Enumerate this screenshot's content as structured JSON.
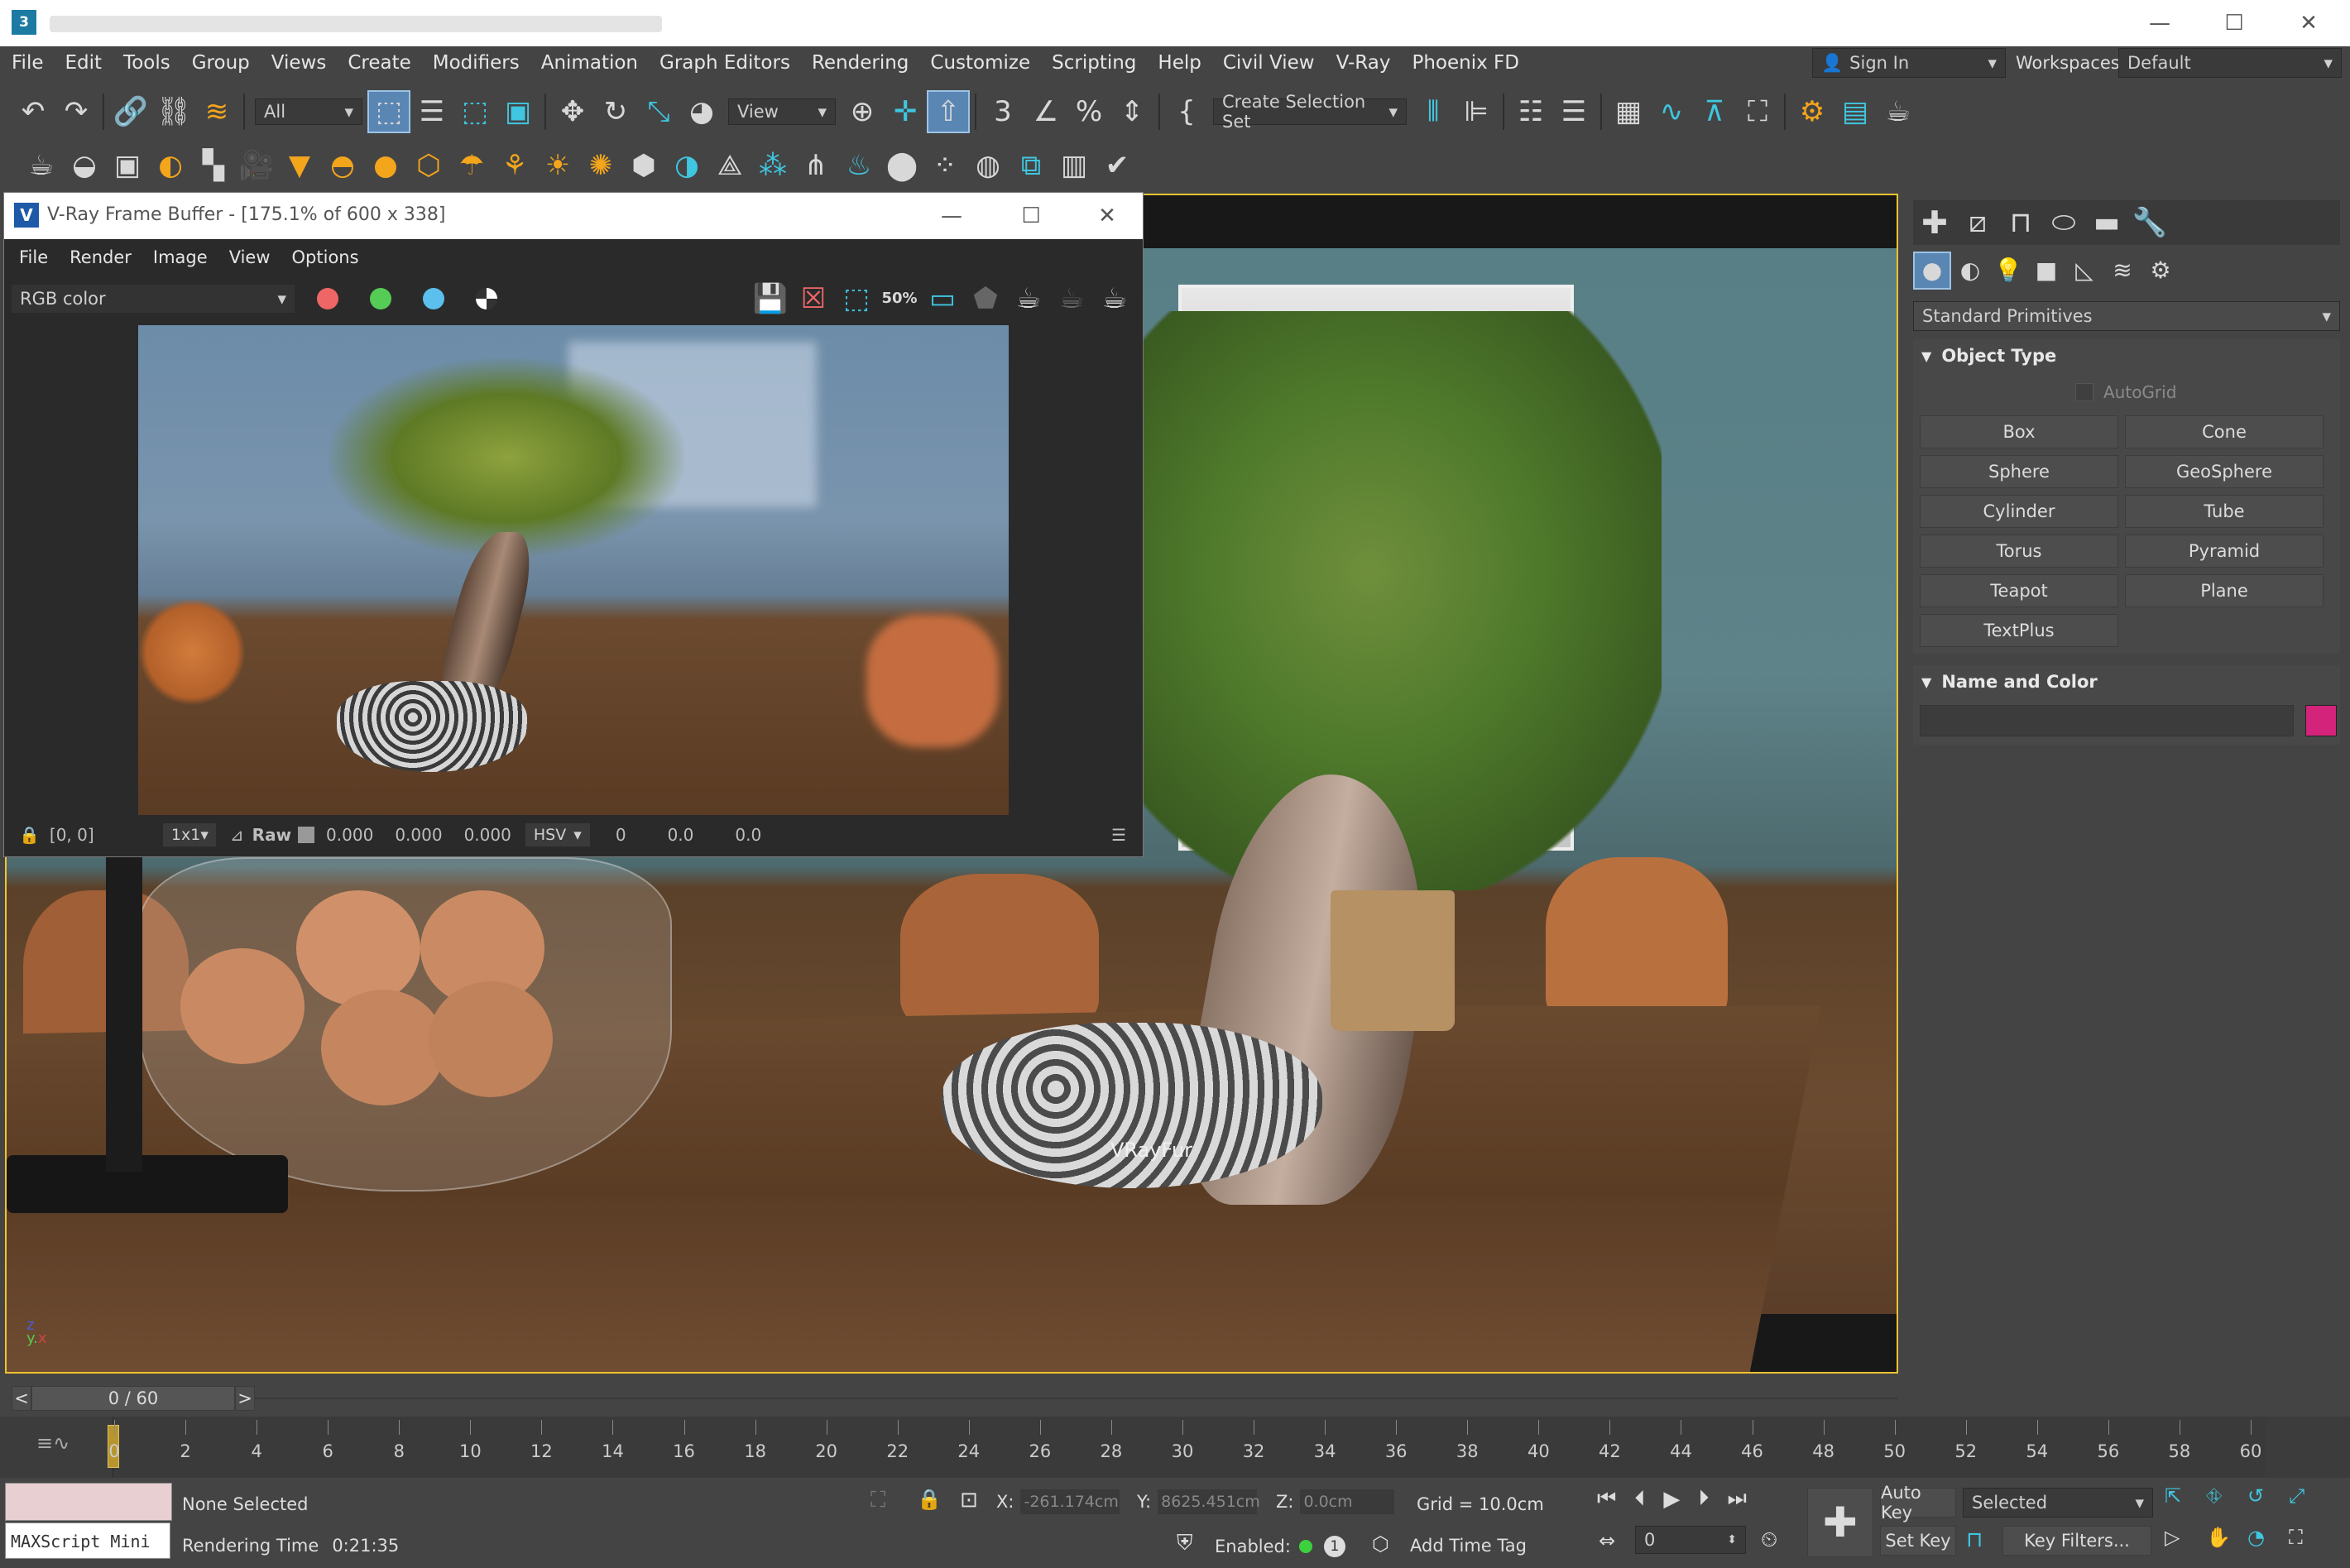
{
  "titlebar": {
    "app_icon": "3",
    "minimize": "—",
    "maximize": "☐",
    "close": "✕"
  },
  "menu": [
    "File",
    "Edit",
    "Tools",
    "Group",
    "Views",
    "Create",
    "Modifiers",
    "Animation",
    "Graph Editors",
    "Rendering",
    "Customize",
    "Scripting",
    "Help",
    "Civil View",
    "V-Ray",
    "Phoenix FD"
  ],
  "account": {
    "sign_in": "Sign In",
    "workspaces_label": "Workspaces:",
    "workspace_value": "Default"
  },
  "toolbar": {
    "filter_value": "All",
    "ref_coord_value": "View",
    "selection_set_placeholder": "Create Selection Set"
  },
  "vfb": {
    "title": "V-Ray Frame Buffer - [175.1% of 600 x 338]",
    "menu": [
      "File",
      "Render",
      "Image",
      "View",
      "Options"
    ],
    "channel_value": "RGB color",
    "zoom_label": "50%",
    "coords": "[0, 0]",
    "sample_size": "1x1",
    "raw_label": "Raw",
    "raw_values": [
      "0.000",
      "0.000",
      "0.000"
    ],
    "color_mode": "HSV",
    "color_values": [
      "0",
      "0.0",
      "0.0"
    ]
  },
  "viewport": {
    "fur_label": "VRayFur",
    "axis_z": "z",
    "axis_y": "y",
    "axis_x": "x"
  },
  "command_panel": {
    "category_value": "Standard Primitives",
    "object_type_title": "Object Type",
    "autogrid_label": "AutoGrid",
    "primitives": [
      "Box",
      "Cone",
      "Sphere",
      "GeoSphere",
      "Cylinder",
      "Tube",
      "Torus",
      "Pyramid",
      "Teapot",
      "Plane",
      "TextPlus"
    ],
    "name_color_title": "Name and Color",
    "object_color": "#d4237a"
  },
  "timeline": {
    "frame_display": "0 / 60",
    "prev": "<",
    "next": ">",
    "ticks": [
      "0",
      "2",
      "4",
      "6",
      "8",
      "10",
      "12",
      "14",
      "16",
      "18",
      "20",
      "22",
      "24",
      "26",
      "28",
      "30",
      "32",
      "34",
      "36",
      "38",
      "40",
      "42",
      "44",
      "46",
      "48",
      "50",
      "52",
      "54",
      "56",
      "58",
      "60"
    ]
  },
  "status": {
    "maxscript_label": "MAXScript Mini",
    "selection_text": "None Selected",
    "rendering_time_label": "Rendering Time",
    "rendering_time_value": "0:21:35",
    "x_label": "X:",
    "x_value": "-261.174cm",
    "y_label": "Y:",
    "y_value": "8625.451cm",
    "z_label": "Z:",
    "z_value": "0.0cm",
    "grid_text": "Grid = 10.0cm",
    "enabled_label": "Enabled:",
    "enabled_count": "1",
    "add_time_tag": "Add Time Tag",
    "auto_key": "Auto Key",
    "key_mode_value": "Selected",
    "set_key": "Set Key",
    "key_filters": "Key Filters...",
    "frame_value": "0"
  }
}
